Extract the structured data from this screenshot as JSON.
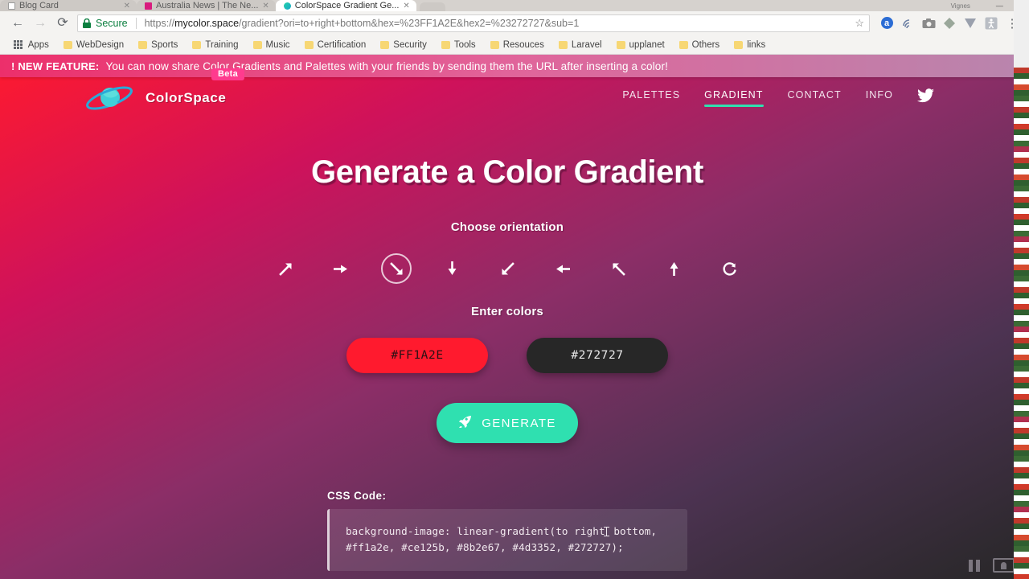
{
  "browser": {
    "tabs": [
      {
        "title": "Blog Card",
        "favicon": "blog-icon",
        "active": false
      },
      {
        "title": "Australia News | The Ne...",
        "favicon": "news-icon",
        "active": false
      },
      {
        "title": "ColorSpace Gradient Ge...",
        "favicon": "colorspace-icon",
        "active": true
      }
    ],
    "window": {
      "minimize": "—",
      "maximize": "❐",
      "close": "✕",
      "profile": "Vignes"
    },
    "nav": {
      "back": "←",
      "forward": "→",
      "reload": "⟳"
    },
    "omnibox": {
      "security_label": "Secure",
      "url_host": "mycolor.space",
      "url_prefix": "https://",
      "url_path": "/gradient?ori=to+right+bottom&hex=%23FF1A2E&hex2=%23272727&sub=1",
      "bookmark_star": "☆"
    },
    "extensions": [
      {
        "name": "amazon-assistant-icon",
        "glyph": "a"
      },
      {
        "name": "wifi-icon",
        "glyph": "◖"
      },
      {
        "name": "screenshot-camera-icon",
        "glyph": "▣"
      },
      {
        "name": "evernote-icon",
        "glyph": "♦"
      },
      {
        "name": "vysor-icon",
        "glyph": "V"
      },
      {
        "name": "accessibility-icon",
        "glyph": "☻"
      },
      {
        "name": "chrome-menu-icon",
        "glyph": "⋮"
      }
    ],
    "bookmarks": [
      "Apps",
      "WebDesign",
      "Sports",
      "Training",
      "Music",
      "Certification",
      "Security",
      "Tools",
      "Resouces",
      "Laravel",
      "upplanet",
      "Others",
      "links"
    ]
  },
  "site": {
    "announcement": {
      "label": "! NEW FEATURE:",
      "text": "You can now share Color Gradients and Palettes with your friends by sending them the URL after inserting a color!"
    },
    "brand": {
      "name": "ColorSpace",
      "badge": "Beta",
      "logo": "planet-icon"
    },
    "nav": [
      {
        "label": "PALETTES",
        "active": false
      },
      {
        "label": "GRADIENT",
        "active": true
      },
      {
        "label": "CONTACT",
        "active": false
      },
      {
        "label": "INFO",
        "active": false
      }
    ],
    "twitter": "twitter-icon"
  },
  "main": {
    "title": "Generate a Color Gradient",
    "orientation_label": "Choose orientation",
    "orientations": [
      {
        "name": "arrow-up-right-icon",
        "value": "to right top",
        "selected": false
      },
      {
        "name": "arrow-right-icon",
        "value": "to right",
        "selected": false
      },
      {
        "name": "arrow-down-right-icon",
        "value": "to right bottom",
        "selected": true
      },
      {
        "name": "arrow-down-icon",
        "value": "to bottom",
        "selected": false
      },
      {
        "name": "arrow-down-left-icon",
        "value": "to left bottom",
        "selected": false
      },
      {
        "name": "arrow-left-icon",
        "value": "to left",
        "selected": false
      },
      {
        "name": "arrow-up-left-icon",
        "value": "to left top",
        "selected": false
      },
      {
        "name": "arrow-up-icon",
        "value": "to top",
        "selected": false
      },
      {
        "name": "radial-icon",
        "value": "radial",
        "selected": false
      }
    ],
    "colors_label": "Enter colors",
    "color1": {
      "value": "#FF1A2E",
      "placeholder": "#FF1A2E",
      "swatch": "#ff1a2e"
    },
    "color2": {
      "value": "#272727",
      "placeholder": "#272727",
      "swatch": "#272727"
    },
    "generate": {
      "label": "GENERATE",
      "icon": "rocket-icon",
      "color": "#2fe0b0"
    },
    "css": {
      "label": "CSS Code:",
      "code_line1": "background-image: linear-gradient(to right",
      "code_line2": "bottom, #ff1a2e, #ce125b, #8b2e67, #4d3352,",
      "code_line3": "#272727);",
      "full": "background-image: linear-gradient(to right bottom, #ff1a2e, #ce125b, #8b2e67, #4d3352, #272727);"
    },
    "gradient_stops": [
      "#ff1a2e",
      "#ce125b",
      "#8b2e67",
      "#4d3352",
      "#272727"
    ]
  },
  "recorder": {
    "pause": "pause-icon",
    "cast": "screen-icon"
  }
}
